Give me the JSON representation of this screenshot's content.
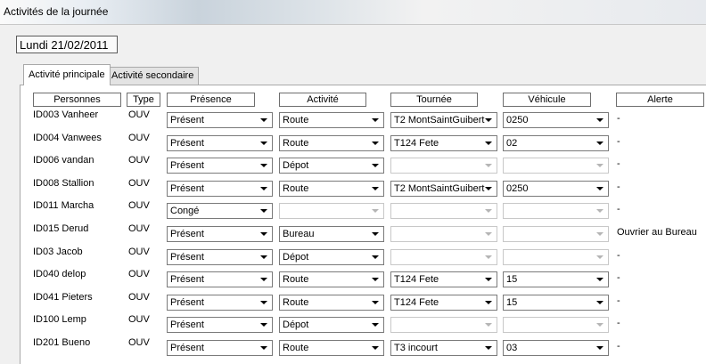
{
  "window": {
    "title": "Activités de la journée"
  },
  "date": "Lundi 21/02/2011",
  "tabs": [
    {
      "label": "Activité principale",
      "active": true
    },
    {
      "label": "Activité secondaire",
      "active": false
    }
  ],
  "columns": {
    "personnes": "Personnes",
    "type": "Type",
    "presence": "Présence",
    "activite": "Activité",
    "tournee": "Tournée",
    "vehicule": "Véhicule",
    "alerte": "Alerte"
  },
  "rows": [
    {
      "person": "ID003 Vanheer",
      "type": "OUV",
      "presence": "Présent",
      "activite": "Route",
      "tournee": "T2 MontSaintGuibert",
      "vehicule": "0250",
      "alerte": "-"
    },
    {
      "person": "ID004 Vanwees",
      "type": "OUV",
      "presence": "Présent",
      "activite": "Route",
      "tournee": "T124 Fete",
      "vehicule": "02",
      "alerte": "-"
    },
    {
      "person": "ID006 vandan",
      "type": "OUV",
      "presence": "Présent",
      "activite": "Dépot",
      "tournee": "",
      "vehicule": "",
      "alerte": "-"
    },
    {
      "person": "ID008 Stallion",
      "type": "OUV",
      "presence": "Présent",
      "activite": "Route",
      "tournee": "T2 MontSaintGuibert",
      "vehicule": "0250",
      "alerte": "-"
    },
    {
      "person": "ID011 Marcha",
      "type": "OUV",
      "presence": "Congé",
      "activite": "",
      "tournee": "",
      "vehicule": "",
      "alerte": "-"
    },
    {
      "person": "ID015 Derud",
      "type": "OUV",
      "presence": "Présent",
      "activite": "Bureau",
      "tournee": "",
      "vehicule": "",
      "alerte": "Ouvrier au Bureau"
    },
    {
      "person": "ID03 Jacob",
      "type": "OUV",
      "presence": "Présent",
      "activite": "Dépot",
      "tournee": "",
      "vehicule": "",
      "alerte": "-"
    },
    {
      "person": "ID040 delop",
      "type": "OUV",
      "presence": "Présent",
      "activite": "Route",
      "tournee": "T124 Fete",
      "vehicule": "15",
      "alerte": "-"
    },
    {
      "person": "ID041 Pieters",
      "type": "OUV",
      "presence": "Présent",
      "activite": "Route",
      "tournee": "T124 Fete",
      "vehicule": "15",
      "alerte": "-"
    },
    {
      "person": "ID100 Lemp",
      "type": "OUV",
      "presence": "Présent",
      "activite": "Dépot",
      "tournee": "",
      "vehicule": "",
      "alerte": "-"
    },
    {
      "person": "ID201 Bueno",
      "type": "OUV",
      "presence": "Présent",
      "activite": "Route",
      "tournee": "T3 incourt",
      "vehicule": "03",
      "alerte": "-"
    }
  ]
}
